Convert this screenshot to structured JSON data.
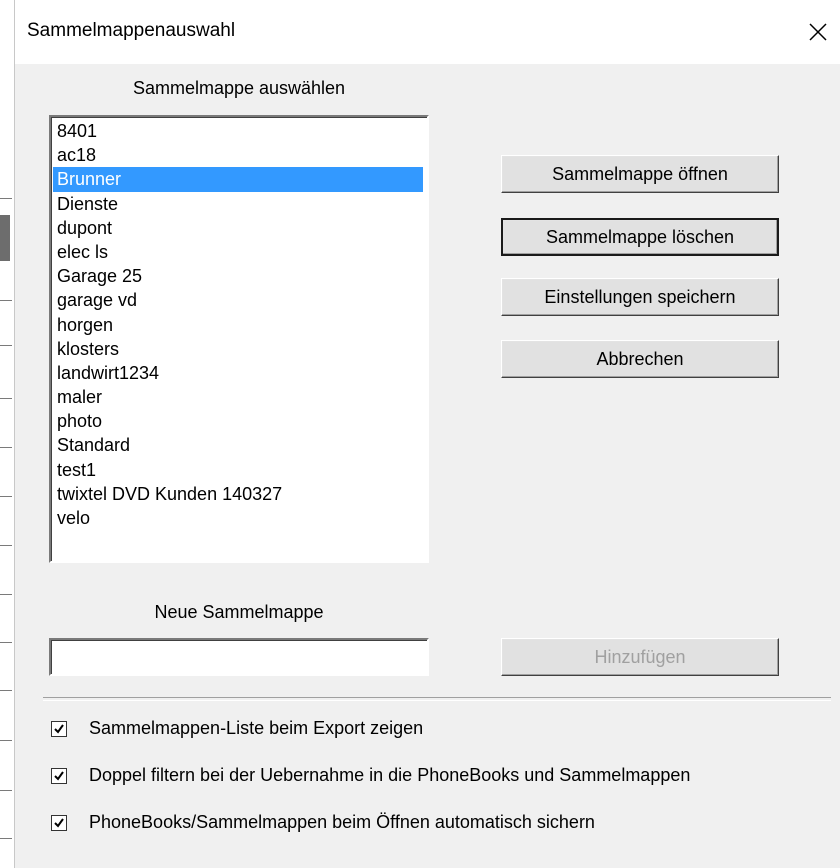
{
  "window": {
    "title": "Sammelmappenauswahl"
  },
  "list": {
    "label": "Sammelmappe auswählen",
    "items": [
      "8401",
      "ac18",
      "Brunner",
      "Dienste",
      "dupont",
      "elec ls",
      "Garage 25",
      "garage vd",
      "horgen",
      "klosters",
      "landwirt1234",
      "maler",
      "photo",
      "Standard",
      "test1",
      "twixtel DVD Kunden 140327",
      "velo"
    ],
    "selected": "Brunner"
  },
  "buttons": {
    "open": "Sammelmappe öffnen",
    "delete": "Sammelmappe löschen",
    "save_settings": "Einstellungen speichern",
    "cancel": "Abbrechen",
    "add": "Hinzufügen"
  },
  "new_folder": {
    "label": "Neue Sammelmappe",
    "value": ""
  },
  "options": [
    {
      "label": "Sammelmappen-Liste beim Export zeigen",
      "checked": true
    },
    {
      "label": "Doppel filtern bei der Uebernahme in die PhoneBooks und Sammelmappen",
      "checked": true
    },
    {
      "label": "PhoneBooks/Sammelmappen beim Öffnen automatisch sichern",
      "checked": true
    }
  ],
  "colors": {
    "selection": "#3399ff",
    "face": "#f0f0f0",
    "titlebar": "#ffffff"
  },
  "icons": {
    "close": "close-icon",
    "check": "checkmark-icon"
  }
}
